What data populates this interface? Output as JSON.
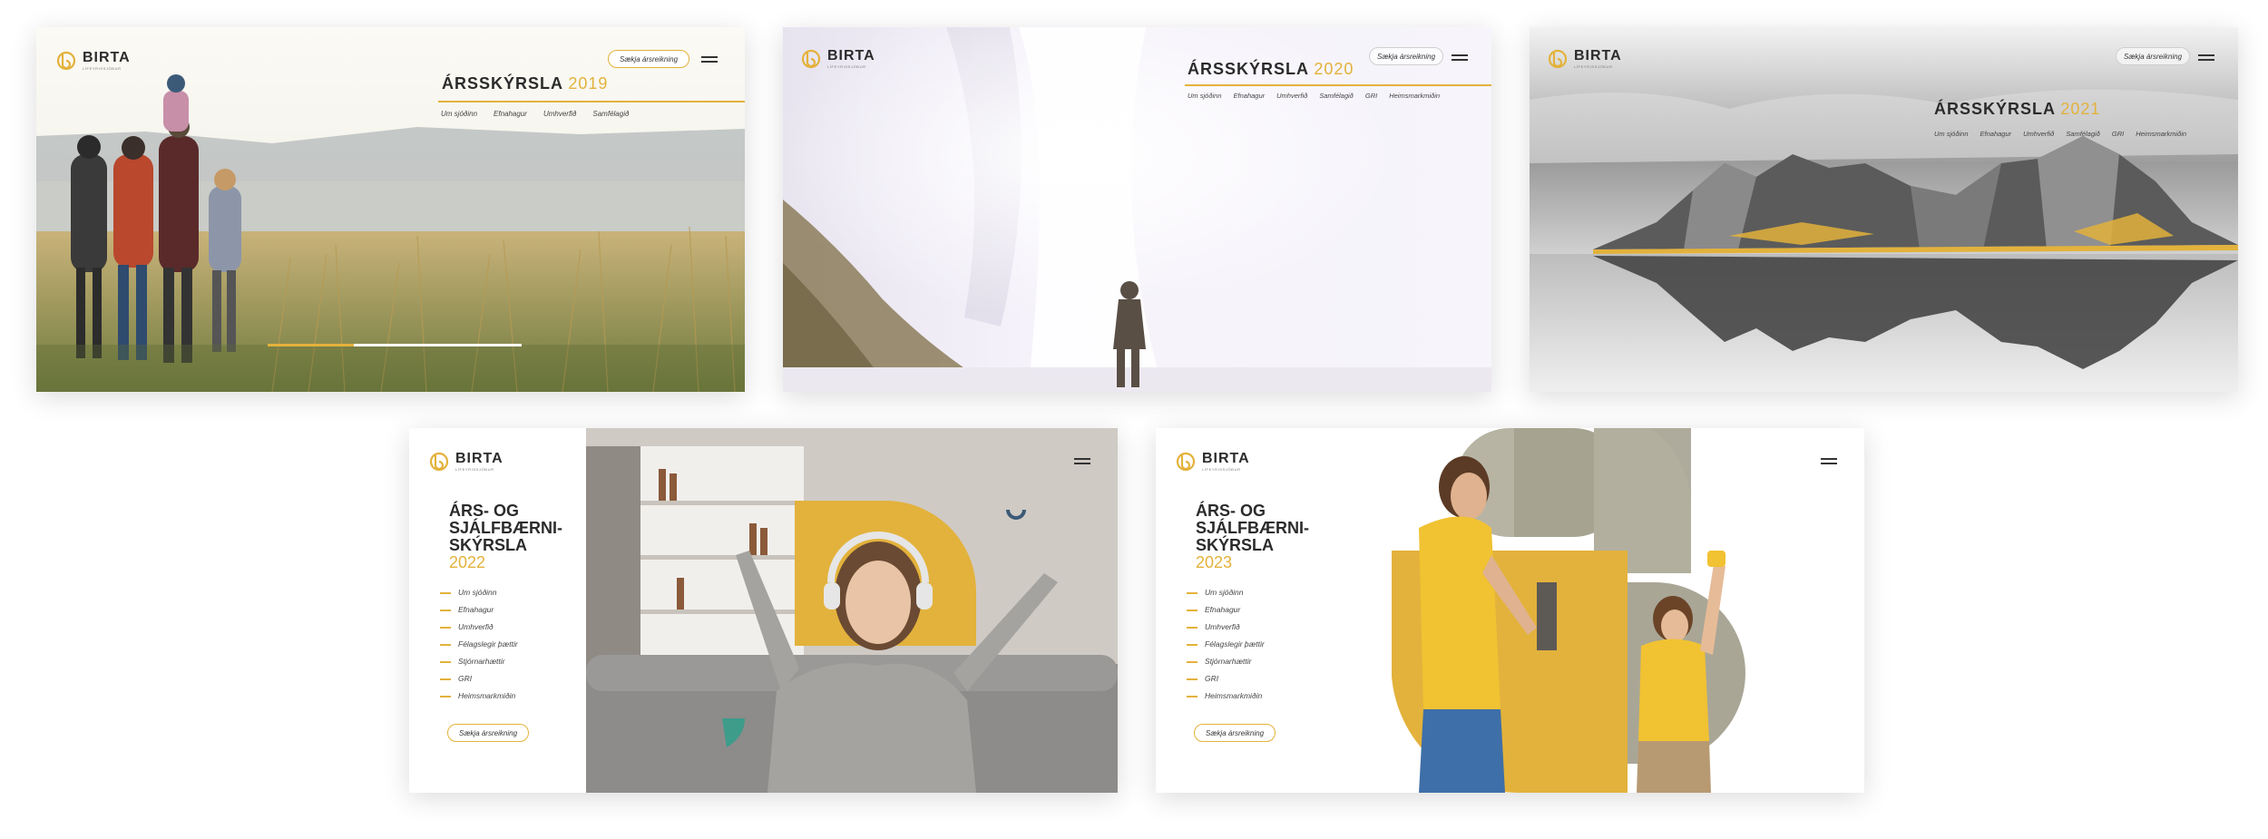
{
  "brand": {
    "name": "BIRTA",
    "sub": "LÍFEYRISSJÓÐUR",
    "accent": "#e3b23c"
  },
  "cta_label": "Sækja ársreikning",
  "cards": [
    {
      "title": "ÁRSSKÝRSLA",
      "year": "2019",
      "nav": [
        "Um sjóðinn",
        "Efnahagur",
        "Umhverfið",
        "Samfélagið"
      ]
    },
    {
      "title": "ÁRSSKÝRSLA",
      "year": "2020",
      "nav": [
        "Um sjóðinn",
        "Efnahagur",
        "Umhverfið",
        "Samfélagið",
        "GRI",
        "Heimsmarkmiðin"
      ]
    },
    {
      "title": "ÁRSSKÝRSLA",
      "year": "2021",
      "nav": [
        "Um sjóðinn",
        "Efnahagur",
        "Umhverfið",
        "Samfélagið",
        "GRI",
        "Heimsmarkmiðin"
      ]
    },
    {
      "title_lines": [
        "ÁRS- OG",
        "SJÁLFBÆRNI-",
        "SKÝRSLA"
      ],
      "year": "2022",
      "nav": [
        "Um sjóðinn",
        "Efnahagur",
        "Umhverfið",
        "Félagslegir þættir",
        "Stjórnarhættir",
        "GRI",
        "Heimsmarkmiðin"
      ]
    },
    {
      "title_lines": [
        "ÁRS- OG",
        "SJÁLFBÆRNI-",
        "SKÝRSLA"
      ],
      "year": "2023",
      "nav": [
        "Um sjóðinn",
        "Efnahagur",
        "Umhverfið",
        "Félagslegir þættir",
        "Stjórnarhættir",
        "GRI",
        "Heimsmarkmiðin"
      ]
    }
  ]
}
